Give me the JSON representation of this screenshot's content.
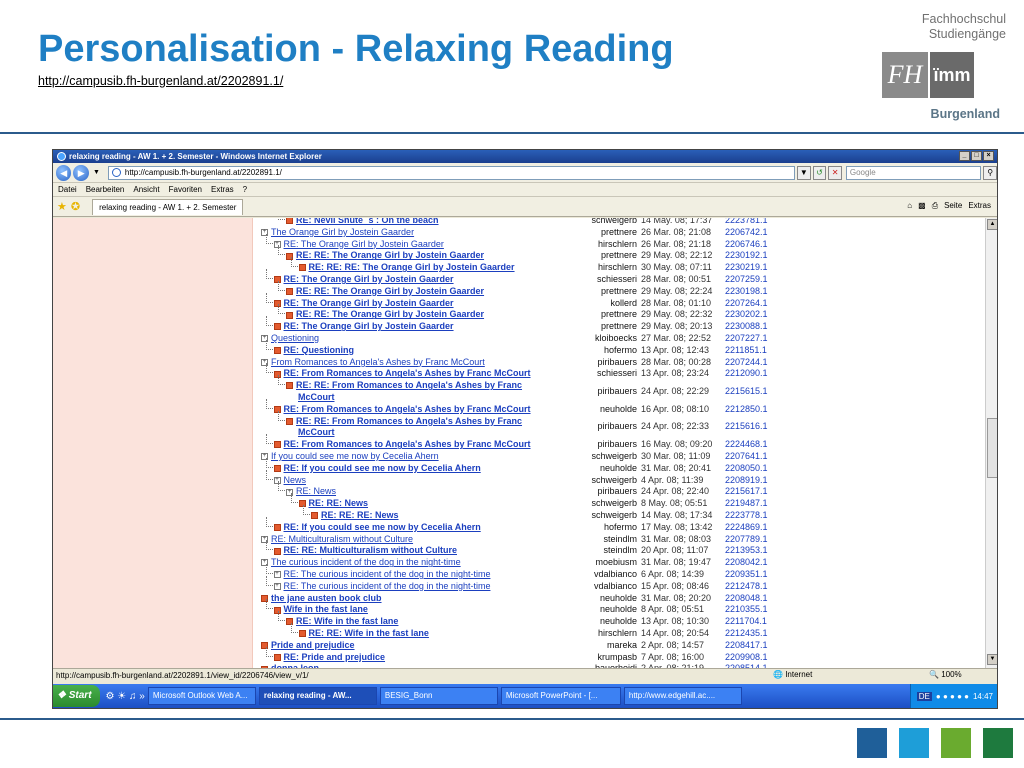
{
  "slide": {
    "title": "Personalisation - Relaxing Reading",
    "link": "http://campusib.fh-burgenland.at/2202891.1/",
    "logo_line1": "Fachhochschul",
    "logo_line2": "Studiengänge",
    "logo_fh": "FH",
    "logo_imm": "ïmm",
    "logo_burgenland": "Burgenland",
    "square_colors": [
      "#1f5f99",
      "#1e9ed8",
      "#6aab2f",
      "#1e7a3e"
    ]
  },
  "browser": {
    "window_title": "relaxing reading - AW 1. + 2. Semester - Windows Internet Explorer",
    "window_buttons": [
      "_",
      "□",
      "×"
    ],
    "url": "http://campusib.fh-burgenland.at/2202891.1/",
    "search_placeholder": "Google",
    "menu": [
      "Datei",
      "Bearbeiten",
      "Ansicht",
      "Favoriten",
      "Extras",
      "?"
    ],
    "tab_title": "relaxing reading - AW 1. + 2. Semester",
    "cmd_seite": "Seite",
    "cmd_extras": "Extras",
    "status_url": "http://campusib.fh-burgenland.at/2202891.1/view_id/2206746/view_v/1/",
    "status_zone": "Internet",
    "status_zoom": "100%"
  },
  "threads": [
    {
      "level": 2,
      "subject": "RE: Nevil Shute ´s : On the beach",
      "bold": true,
      "reply": true,
      "author": "schweigerb",
      "date": "14 May. 08; 17:37",
      "id": "2223781.1"
    },
    {
      "level": 0,
      "subject": "The Orange Girl by Jostein Gaarder",
      "bold": false,
      "reply": false,
      "author": "prettnere",
      "date": "26 Mar. 08; 21:08",
      "id": "2206742.1"
    },
    {
      "level": 1,
      "subject": "RE: The Orange Girl by Jostein Gaarder",
      "bold": false,
      "reply": false,
      "author": "hirschlern",
      "date": "26 Mar. 08; 21:18",
      "id": "2206746.1"
    },
    {
      "level": 2,
      "subject": "RE: RE: The Orange Girl by Jostein Gaarder",
      "bold": true,
      "reply": true,
      "author": "prettnere",
      "date": "29 May. 08; 22:12",
      "id": "2230192.1"
    },
    {
      "level": 3,
      "subject": "RE: RE: RE: The Orange Girl by Jostein Gaarder",
      "bold": true,
      "reply": true,
      "author": "hirschlern",
      "date": "30 May. 08; 07:11",
      "id": "2230219.1"
    },
    {
      "level": 1,
      "subject": "RE: The Orange Girl by Jostein Gaarder",
      "bold": true,
      "reply": true,
      "author": "schiesseri",
      "date": "28 Mar. 08; 00:51",
      "id": "2207259.1"
    },
    {
      "level": 2,
      "subject": "RE: RE: The Orange Girl by Jostein Gaarder",
      "bold": true,
      "reply": true,
      "author": "prettnere",
      "date": "29 May. 08; 22:24",
      "id": "2230198.1"
    },
    {
      "level": 1,
      "subject": "RE: The Orange Girl by Jostein Gaarder",
      "bold": true,
      "reply": true,
      "author": "kollerd",
      "date": "28 Mar. 08; 01:10",
      "id": "2207264.1"
    },
    {
      "level": 2,
      "subject": "RE: RE: The Orange Girl by Jostein Gaarder",
      "bold": true,
      "reply": true,
      "author": "prettnere",
      "date": "29 May. 08; 22:32",
      "id": "2230202.1"
    },
    {
      "level": 1,
      "subject": "RE: The Orange Girl by Jostein Gaarder",
      "bold": true,
      "reply": true,
      "author": "prettnere",
      "date": "29 May. 08; 20:13",
      "id": "2230088.1"
    },
    {
      "level": 0,
      "subject": "Questioning",
      "bold": false,
      "reply": false,
      "author": "kloiboecks",
      "date": "27 Mar. 08; 22:52",
      "id": "2207227.1"
    },
    {
      "level": 1,
      "subject": "RE: Questioning",
      "bold": true,
      "reply": true,
      "author": "hofermo",
      "date": "13 Apr. 08; 12:43",
      "id": "2211851.1"
    },
    {
      "level": 0,
      "subject": "From Romances to Angela's Ashes by Franc McCourt",
      "bold": false,
      "reply": false,
      "author": "piribauers",
      "date": "28 Mar. 08; 00:28",
      "id": "2207244.1"
    },
    {
      "level": 1,
      "subject": "RE: From Romances to Angela's Ashes by Franc McCourt",
      "bold": true,
      "reply": true,
      "author": "schiesseri",
      "date": "13 Apr. 08; 23:24",
      "id": "2212090.1"
    },
    {
      "level": 2,
      "subject": "RE: RE: From Romances to Angela's Ashes by Franc",
      "subject2": "McCourt",
      "bold": true,
      "reply": true,
      "author": "piribauers",
      "date": "24 Apr. 08; 22:29",
      "id": "2215615.1"
    },
    {
      "level": 1,
      "subject": "RE: From Romances to Angela's Ashes by Franc McCourt",
      "bold": true,
      "reply": true,
      "author": "neuholde",
      "date": "16 Apr. 08; 08:10",
      "id": "2212850.1"
    },
    {
      "level": 2,
      "subject": "RE: RE: From Romances to Angela's Ashes by Franc",
      "subject2": "McCourt",
      "bold": true,
      "reply": true,
      "author": "piribauers",
      "date": "24 Apr. 08; 22:33",
      "id": "2215616.1"
    },
    {
      "level": 1,
      "subject": "RE: From Romances to Angela's Ashes by Franc McCourt",
      "bold": true,
      "reply": true,
      "author": "piribauers",
      "date": "16 May. 08; 09:20",
      "id": "2224468.1"
    },
    {
      "level": 0,
      "subject": "If you could see me now by Cecelia Ahern",
      "bold": false,
      "reply": false,
      "author": "schweigerb",
      "date": "30 Mar. 08; 11:09",
      "id": "2207641.1"
    },
    {
      "level": 1,
      "subject": "RE: If you could see me now by Cecelia Ahern",
      "bold": true,
      "reply": true,
      "author": "neuholde",
      "date": "31 Mar. 08; 20:41",
      "id": "2208050.1"
    },
    {
      "level": 1,
      "subject": "News",
      "bold": false,
      "reply": false,
      "author": "schweigerb",
      "date": "4 Apr. 08; 11:39",
      "id": "2208919.1"
    },
    {
      "level": 2,
      "subject": "RE: News",
      "bold": false,
      "reply": false,
      "author": "piribauers",
      "date": "24 Apr. 08; 22:40",
      "id": "2215617.1"
    },
    {
      "level": 3,
      "subject": "RE: RE: News",
      "bold": true,
      "reply": true,
      "author": "schweigerb",
      "date": "8 May. 08; 05:51",
      "id": "2219487.1"
    },
    {
      "level": 4,
      "subject": "RE: RE: RE: News",
      "bold": true,
      "reply": true,
      "author": "schweigerb",
      "date": "14 May. 08; 17:34",
      "id": "2223778.1"
    },
    {
      "level": 1,
      "subject": "RE: If you could see me now by Cecelia Ahern",
      "bold": true,
      "reply": true,
      "author": "hofermo",
      "date": "17 May. 08; 13:42",
      "id": "2224869.1"
    },
    {
      "level": 0,
      "subject": "RE: Multiculturalism without Culture",
      "bold": false,
      "reply": false,
      "author": "steindlm",
      "date": "31 Mar. 08; 08:03",
      "id": "2207789.1"
    },
    {
      "level": 1,
      "subject": "RE: RE: Multiculturalism without Culture",
      "bold": true,
      "reply": true,
      "author": "steindlm",
      "date": "20 Apr. 08; 11:07",
      "id": "2213953.1"
    },
    {
      "level": 0,
      "subject": "The curious incident of the dog in the night-time",
      "bold": false,
      "reply": false,
      "author": "moebiusm",
      "date": "31 Mar. 08; 19:47",
      "id": "2208042.1"
    },
    {
      "level": 1,
      "subject": "RE: The curious incident of the dog in the night-time",
      "bold": false,
      "reply": false,
      "author": "vdalbianco",
      "date": "6 Apr. 08; 14:39",
      "id": "2209351.1"
    },
    {
      "level": 1,
      "subject": "RE: The curious incident of the dog in the night-time",
      "bold": false,
      "reply": false,
      "author": "vdalbianco",
      "date": "15 Apr. 08; 08:46",
      "id": "2212478.1"
    },
    {
      "level": 0,
      "subject": "the jane austen book club",
      "bold": true,
      "reply": true,
      "author": "neuholde",
      "date": "31 Mar. 08; 20:20",
      "id": "2208048.1"
    },
    {
      "level": 1,
      "subject": "Wife in the fast lane",
      "bold": true,
      "reply": true,
      "author": "neuholde",
      "date": "8 Apr. 08; 05:51",
      "id": "2210355.1"
    },
    {
      "level": 2,
      "subject": "RE: Wife in the fast lane",
      "bold": true,
      "reply": true,
      "author": "neuholde",
      "date": "13 Apr. 08; 10:30",
      "id": "2211704.1"
    },
    {
      "level": 3,
      "subject": "RE: RE: Wife in the fast lane",
      "bold": true,
      "reply": true,
      "author": "hirschlern",
      "date": "14 Apr. 08; 20:54",
      "id": "2212435.1"
    },
    {
      "level": 0,
      "subject": "Pride and prejudice",
      "bold": true,
      "reply": true,
      "author": "mareka",
      "date": "2 Apr. 08; 14:57",
      "id": "2208417.1"
    },
    {
      "level": 1,
      "subject": "RE: Pride and prejudice",
      "bold": true,
      "reply": true,
      "author": "krumpasb",
      "date": "7 Apr. 08; 16:00",
      "id": "2209908.1"
    },
    {
      "level": 0,
      "subject": "donna leon",
      "bold": true,
      "reply": true,
      "author": "bauerheidi",
      "date": "2 Apr. 08; 21:19",
      "id": "2208514.1"
    }
  ],
  "taskbar": {
    "start": "Start",
    "tasks": [
      "Microsoft Outlook Web A...",
      "relaxing reading - AW...",
      "BESIG_Bonn",
      "Microsoft PowerPoint - [...",
      "http://www.edgehill.ac...."
    ],
    "lang": "DE",
    "clock": "14:47"
  }
}
